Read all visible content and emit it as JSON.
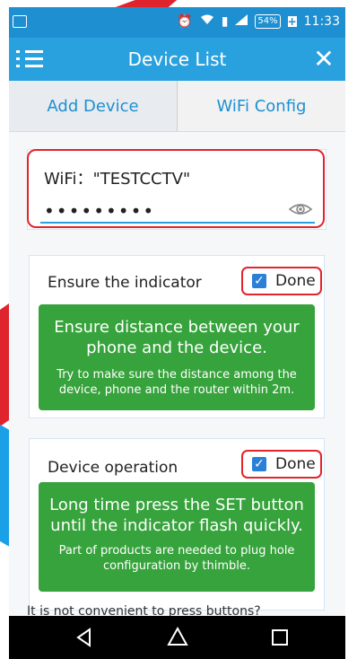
{
  "status": {
    "time": "11:33",
    "battery": "54%",
    "battery_charge": "+"
  },
  "appbar": {
    "title": "Device List",
    "close": "✕"
  },
  "tabs": [
    {
      "label": "Add Device"
    },
    {
      "label": "WiFi Config"
    }
  ],
  "wifi": {
    "label": "WiFi：\"TESTCCTV\"",
    "password_mask": "•••••••••"
  },
  "steps": [
    {
      "title": "Ensure the indicator",
      "done_label": "Done",
      "main_text": "Ensure distance between your phone and the device.",
      "sub_text": "Try to make sure the distance among the device, phone and the router within 2m."
    },
    {
      "title": "Device operation",
      "done_label": "Done",
      "main_text": "Long time press the SET button until the indicator flash quickly.",
      "sub_text": "Part of products are needed to plug hole configuration by thimble."
    }
  ],
  "hint": "It is not convenient to press buttons?",
  "colors": {
    "primary": "#2aa1df",
    "statusbar": "#1e8fd1",
    "green": "#37a33c",
    "highlight": "#e2242d"
  },
  "icons": [
    "menu-icon",
    "close-icon",
    "eye-icon",
    "checkbox-icon",
    "back-icon",
    "home-icon",
    "recents-icon"
  ]
}
